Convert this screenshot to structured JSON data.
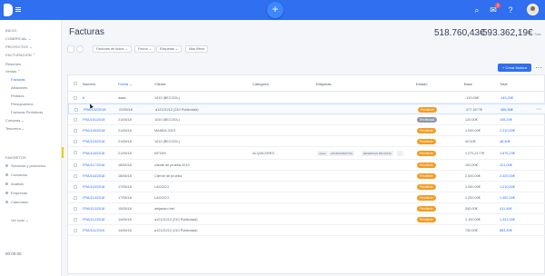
{
  "header": {
    "brand_color": "#2f6ff0",
    "fab_icon": "+",
    "notifications": "1"
  },
  "sidebar": {
    "sections": [
      {
        "label": "INICIO"
      },
      {
        "label": "COMERCIAL ⌄"
      },
      {
        "label": "PROYECTOS ⌄"
      },
      {
        "label": "FACTURACIÓN ⌃"
      },
      {
        "label": "Resumen"
      },
      {
        "label": "Ventas ⌃"
      },
      {
        "label": "Facturas"
      },
      {
        "label": "Albaranes"
      },
      {
        "label": "Pedidos"
      },
      {
        "label": "Presupuestos"
      },
      {
        "label": "Facturas Periódicas"
      },
      {
        "label": "Compras ⌄"
      },
      {
        "label": "Tesorería ⌄"
      }
    ],
    "favorites_title": "FAVORITOS",
    "favorites": [
      {
        "label": "Servicios y productos"
      },
      {
        "label": "Contactos"
      },
      {
        "label": "Análisis"
      },
      {
        "label": "Empresas"
      },
      {
        "label": "Calendario"
      }
    ],
    "more_label": "Ver todo ⌄",
    "clock": "00:00:00"
  },
  "main": {
    "title": "Facturas",
    "total_base": "518.760,43€",
    "total_base_label": "Base",
    "total_amount": "593.362,19€",
    "total_amount_label": "Total",
    "filters": [
      "Facturas de todos ⌄",
      "Fecha ⌄",
      "Etiquetas ⌄",
      "Más filtros"
    ],
    "new_button": "+ Crear factura",
    "columns": [
      "Número",
      "Fecha ⌄",
      "Cliente",
      "Categoría",
      "Etiquetas",
      "Estado",
      "Base",
      "Total"
    ],
    "rows": [
      {
        "number": "8",
        "date": "aaaa",
        "client": "1010 (BECOOL)",
        "category": "",
        "tags": [],
        "status": "",
        "base": "-120,00€",
        "total": "-145,20€"
      },
      {
        "number": "FRA/102/2018",
        "date": "22/05/18",
        "client": "a12121212 (210 Publicidad)",
        "category": "",
        "tags": [],
        "status": "Pendiente",
        "base": "377,16??€",
        "total": "456,36€"
      },
      {
        "number": "FRA/101/2018",
        "date": "21/05/18",
        "client": "1010 (BECOOL)",
        "category": "",
        "tags": [],
        "status": "Rectificada",
        "base": "120,00€",
        "total": "145,20€"
      },
      {
        "number": "FRA/100/2018",
        "date": "21/05/18",
        "client": "MANDA 2019",
        "category": "",
        "tags": [],
        "status": "Pendiente",
        "base": "1.000,00€",
        "total": "1.210,00€"
      },
      {
        "number": "FRA/119/2018",
        "date": "21/05/18",
        "client": "1010 (BECOOL)",
        "category": "",
        "tags": [],
        "status": "Pendiente",
        "base": "40,00€",
        "total": "48,40€"
      },
      {
        "number": "FRA/118/2018",
        "date": "21/05/18",
        "client": "KEYAH",
        "category": "ALQUILERES",
        "tags": [
          "casas",
          "APARTAMENTOS",
          "RESERVAS BOOKING",
          "..."
        ],
        "status": "Pendiente",
        "base": "1.275,21??€",
        "total": "1.876,23€"
      },
      {
        "number": "FRA/117/2018",
        "date": "18/05/18",
        "client": "cliente de prueba 2019",
        "category": "",
        "tags": [],
        "status": "Pendiente",
        "base": "100,00€",
        "total": "121,00€"
      },
      {
        "number": "FRA/116/2018",
        "date": "18/05/18",
        "client": "Cliente de prueba",
        "category": "",
        "tags": [],
        "status": "Pendiente",
        "base": "2.000,00€",
        "total": "2.420,00€"
      },
      {
        "number": "FRA/115/2018",
        "date": "17/05/18",
        "client": "LAGOCO",
        "category": "",
        "tags": [],
        "status": "Pendiente",
        "base": "1.000,00€",
        "total": "1.210,00€"
      },
      {
        "number": "FRA/114/2018",
        "date": "17/05/18",
        "client": "LAGOCO",
        "category": "",
        "tags": [],
        "status": "Pendiente",
        "base": "1.200,00€",
        "total": "1.452,00€"
      },
      {
        "number": "FRA/113/2018",
        "date": "15/05/18",
        "client": "alejandro bel.",
        "category": "",
        "tags": [],
        "status": "Pendiente",
        "base": "340,00€",
        "total": "411,40€"
      },
      {
        "number": "FRA/112/2018",
        "date": "14/05/18",
        "client": "a12121212 (210 Publicidad)",
        "category": "",
        "tags": [],
        "status": "Pendiente",
        "base": "1.100,00€",
        "total": "1.331,00€"
      },
      {
        "number": "FRA/111/2018",
        "date": "14/05/18",
        "client": "a12121212 (210 Publicidad)",
        "category": "",
        "tags": [],
        "status": "",
        "base": "730,00€",
        "total": "883,30€"
      }
    ],
    "status_colors": {
      "Pendiente": "#f59b23",
      "Rectificada": "#8f98a5"
    }
  }
}
